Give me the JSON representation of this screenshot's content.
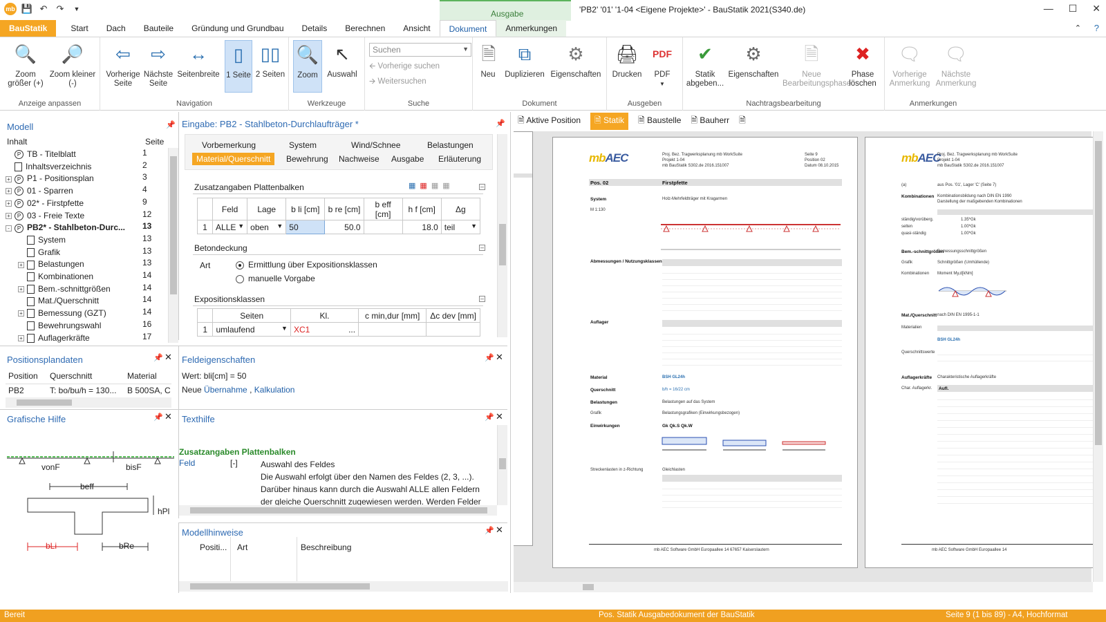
{
  "window": {
    "title": "'PB2' '01' '1-04 <Eigene Projekte>' - BauStatik 2021(S340.de)",
    "context_tab_group": "Ausgabe"
  },
  "tabs": [
    "BauStatik",
    "Start",
    "Dach",
    "Bauteile",
    "Gründung und Grundbau",
    "Details",
    "Berechnen",
    "Ansicht",
    "Dokument",
    "Anmerkungen"
  ],
  "ribbon": {
    "groups": {
      "anzeige": "Anzeige anpassen",
      "navigation": "Navigation",
      "werkzeuge": "Werkzeuge",
      "suche": "Suche",
      "dokument": "Dokument",
      "ausgeben": "Ausgeben",
      "nachtrag": "Nachtragsbearbeitung",
      "anmerkungen": "Anmerkungen"
    },
    "buttons": {
      "zoom_in": "Zoom größer (+)",
      "zoom_out": "Zoom kleiner (-)",
      "prev_page": "Vorherige Seite",
      "next_page": "Nächste Seite",
      "page_width": "Seitenbreite",
      "one_page": "1 Seite",
      "two_pages": "2 Seiten",
      "zoom": "Zoom",
      "select": "Auswahl",
      "new": "Neu",
      "duplicate": "Duplizieren",
      "properties": "Eigenschaften",
      "print": "Drucken",
      "pdf": "PDF",
      "submit_statics": "Statik abgeben...",
      "properties2": "Eigenschaften",
      "new_phase": "Neue Bearbeitungsphase",
      "delete_phase": "Phase löschen",
      "prev_note": "Vorherige Anmerkung",
      "next_note": "Nächste Anmerkung"
    },
    "search": {
      "placeholder": "Suchen",
      "prev": "Vorherige suchen",
      "next": "Weitersuchen"
    }
  },
  "model_panel": {
    "title": "Modell",
    "col_content": "Inhalt",
    "col_page": "Seite",
    "items": [
      {
        "label": "TB - Titelblatt",
        "page": "1"
      },
      {
        "label": "Inhaltsverzeichnis",
        "page": "2"
      },
      {
        "label": "P1 - Positionsplan",
        "page": "3"
      },
      {
        "label": "01 - Sparren",
        "page": "4"
      },
      {
        "label": "02* - Firstpfette",
        "page": "9"
      },
      {
        "label": "03 - Freie Texte",
        "page": "12"
      },
      {
        "label": "PB2* - Stahlbeton-Durc...",
        "page": "13"
      },
      {
        "label": "System",
        "page": "13"
      },
      {
        "label": "Grafik",
        "page": "13"
      },
      {
        "label": "Belastungen",
        "page": "13"
      },
      {
        "label": "Kombinationen",
        "page": "14"
      },
      {
        "label": "Bem.-schnittgrößen",
        "page": "14"
      },
      {
        "label": "Mat./Querschnitt",
        "page": "14"
      },
      {
        "label": "Bemessung (GZT)",
        "page": "14"
      },
      {
        "label": "Bewehrungswahl",
        "page": "16"
      },
      {
        "label": "Auflagerkräfte",
        "page": "17"
      }
    ]
  },
  "position_plan": {
    "title": "Positionsplandaten",
    "cols": [
      "Position",
      "Querschnitt",
      "Material"
    ],
    "row": [
      "PB2",
      "T: bo/bu/h = 130...",
      "B 500SA, C"
    ]
  },
  "graphic_help": {
    "title": "Grafische Hilfe",
    "labels": {
      "vonF": "vonF",
      "bisF": "bisF",
      "beff": "beff",
      "hPl": "hPl",
      "bLi": "bLi",
      "bRe": "bRe"
    }
  },
  "input_panel": {
    "title": "Eingabe: PB2 - Stahlbeton-Durchlaufträger *",
    "nav_row1": [
      "Vorbemerkung",
      "System",
      "Wind/Schnee",
      "Belastungen"
    ],
    "nav_row2": [
      "Material/Querschnitt",
      "Bewehrung",
      "Nachweise",
      "Ausgabe",
      "Erläuterung"
    ],
    "section1": "Zusatzangaben Plattenbalken",
    "table1": {
      "headers": [
        "",
        "Feld",
        "Lage",
        "b li [cm]",
        "b re [cm]",
        "b eff [cm]",
        "h f [cm]",
        "Δg"
      ],
      "row": [
        "1",
        "ALLE",
        "oben",
        "50",
        "50.0",
        "",
        "18.0",
        "teil"
      ]
    },
    "section2": "Betondeckung",
    "art_label": "Art",
    "radio1": "Ermittlung über Expositionsklassen",
    "radio2": "manuelle Vorgabe",
    "section3": "Expositionsklassen",
    "table2": {
      "headers": [
        "",
        "Seiten",
        "Kl.",
        "c min,dur [mm]",
        "Δc dev [mm]"
      ],
      "row": [
        "1",
        "umlaufend",
        "XC1",
        "...",
        "",
        ""
      ]
    }
  },
  "field_props": {
    "title": "Feldeigenschaften",
    "value_line": "Wert: bli[cm] = 50",
    "new_prefix": "Neue",
    "link1": "Übernahme",
    "sep": ",",
    "link2": "Kalkulation"
  },
  "help_text": {
    "title": "Texthilfe",
    "heading": "Zusatzangaben Plattenbalken",
    "field": "Feld",
    "unit": "[-]",
    "lines": [
      "Auswahl des Feldes",
      "Die Auswahl erfolgt über den Namen des Feldes (2, 3, ...).",
      "Darüber hinaus kann durch die Auswahl ALLE allen Feldern",
      "der gleiche Querschnitt zugewiesen werden. Werden Felder"
    ]
  },
  "model_hints": {
    "title": "Modellhinweise",
    "cols": [
      "Positi...",
      "Art",
      "Beschreibung"
    ]
  },
  "doc_tabs": [
    "Aktive Position",
    "Statik",
    "Baustelle",
    "Bauherr"
  ],
  "page1": {
    "header": [
      "Proj. Bez. Tragwerksplanung mb WorkSuite",
      "Projekt 1-04",
      "mb BauStatik S302.de 2016.151007"
    ],
    "header_right": [
      "Seite 9",
      "Position 02",
      "Datum 08.10.2015"
    ],
    "pos": "Pos. 02",
    "pos_name": "Firstpfette",
    "rows": [
      [
        "System",
        "Holz-Mehrfeldträger mit Kragarmen"
      ],
      [
        "M 1:130",
        ""
      ],
      [
        "Abmessungen / Nutzungsklassen",
        ""
      ],
      [
        "Auflager",
        ""
      ],
      [
        "Material",
        "BSH GL24h"
      ],
      [
        "Querschnitt",
        "b/h = 16/22 cm"
      ],
      [
        "Belastungen",
        "Belastungen auf das System"
      ],
      [
        "Grafik",
        "Belastungsgrafiken (Einwirkungsbezogen)"
      ],
      [
        "Einwirkungen",
        "Gk        Qk.S        Qk.W"
      ],
      [
        "Streckenlasten in z-Richtung",
        "Gleichlasten"
      ]
    ],
    "footer": "mb AEC Software GmbH    Europaallee 14    67657 Kaiserslautern"
  },
  "page2": {
    "rows": [
      [
        "(a)",
        "aus Pos. '01', Lager 'C' (Seite 7)"
      ],
      [
        "Kombinationen",
        "Kombinationsbildung nach DIN EN 1990"
      ],
      [
        "",
        "Darstellung der maßgebenden Kombinationen"
      ],
      [
        "ständig/vorüberg.",
        "1.35*Gk"
      ],
      [
        "selten",
        "1.00*Gk"
      ],
      [
        "quasi-ständig",
        "1.00*Gk"
      ],
      [
        "Bem.-schnittgrößen",
        "Bemessungsschnittgrößen"
      ],
      [
        "Grafik",
        "Schnittgrößen (Umhüllende)"
      ],
      [
        "Kombinationen",
        "Moment My,d[kNm]"
      ],
      [
        "Mat./Querschnitt",
        "nach DIN EN 1995-1-1"
      ],
      [
        "Materialien",
        "BSH GL24h"
      ],
      [
        "Querschnittswerte",
        ""
      ],
      [
        "Auflagerkräfte",
        "Charakteristische Auflagerkräfte"
      ],
      [
        "Char. Auflagerkr.",
        "Aufl."
      ]
    ],
    "footer": "mb AEC Software GmbH    Europaallee 14"
  },
  "status": {
    "left": "Bereit",
    "center": "Pos. Statik  Ausgabedokument der BauStatik",
    "right": "Seite 9 (1 bis 89) - A4, Hochformat"
  },
  "colors": {
    "accent": "#f5a623",
    "link": "#1f5fa8",
    "panel_title": "#2f6bb3"
  }
}
